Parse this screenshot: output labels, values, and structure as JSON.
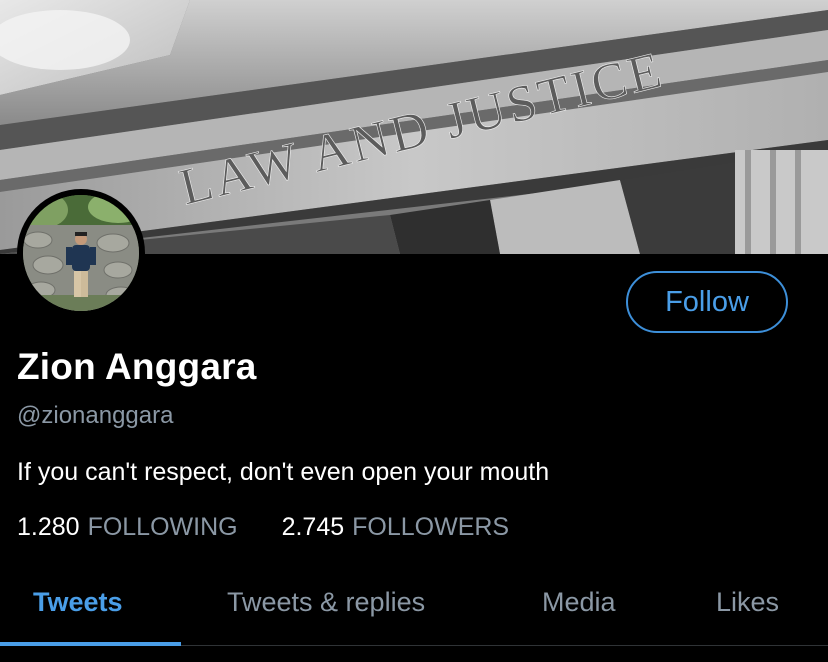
{
  "banner": {
    "inscription": "LAW AND JUSTICE"
  },
  "profile": {
    "display_name": "Zion Anggara",
    "handle": "@zionanggara",
    "bio": "If you can't respect, don't even open your mouth",
    "follow_label": "Follow"
  },
  "stats": {
    "following_count": "1.280",
    "following_label": "FOLLOWING",
    "followers_count": "2.745",
    "followers_label": "FOLLOWERS"
  },
  "tabs": [
    {
      "label": "Tweets",
      "active": true
    },
    {
      "label": "Tweets & replies",
      "active": false
    },
    {
      "label": "Media",
      "active": false
    },
    {
      "label": "Likes",
      "active": false
    }
  ],
  "colors": {
    "accent": "#4a9ee8",
    "background": "#000000",
    "secondary_text": "#8b98a5"
  }
}
